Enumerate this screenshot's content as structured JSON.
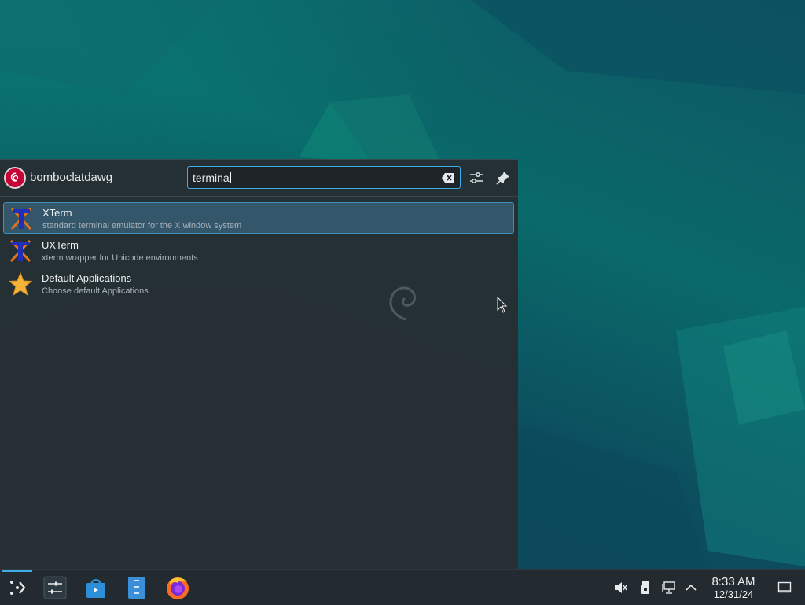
{
  "launcher": {
    "user_name": "bomboclatdawg",
    "search": {
      "value": "termina",
      "placeholder": ""
    },
    "results": [
      {
        "title": "XTerm",
        "subtitle": "standard terminal emulator for the X window system",
        "icon": "xterm-icon",
        "selected": true
      },
      {
        "title": "UXTerm",
        "subtitle": "xterm wrapper for Unicode environments",
        "icon": "xterm-icon",
        "selected": false
      },
      {
        "title": "Default Applications",
        "subtitle": "Choose default Applications",
        "icon": "star-icon",
        "selected": false
      }
    ]
  },
  "taskbar": {
    "pinned": [
      "app-launcher-icon",
      "system-settings-icon",
      "discover-store-icon",
      "file-manager-icon",
      "firefox-icon"
    ],
    "tray": [
      "volume-muted-icon",
      "removable-device-icon",
      "network-icon",
      "show-hidden-icons-icon"
    ],
    "clock": {
      "time": "8:33 AM",
      "date": "12/31/24"
    }
  },
  "colors": {
    "accent": "#3daee9",
    "panel": "#262e34",
    "taskbar": "#232a30"
  }
}
